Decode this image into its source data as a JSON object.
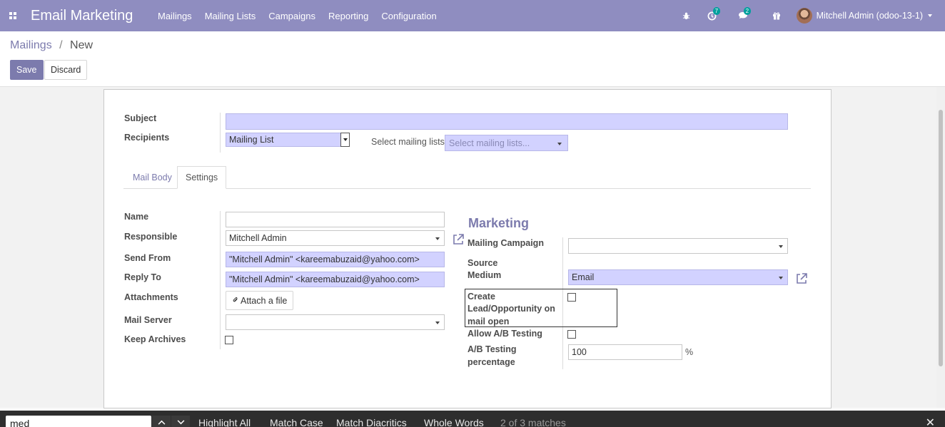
{
  "navbar": {
    "brand": "Email Marketing",
    "menu": [
      "Mailings",
      "Mailing Lists",
      "Campaigns",
      "Reporting",
      "Configuration"
    ],
    "activity_count": "7",
    "messages_count": "2",
    "user": "Mitchell Admin (odoo-13-1)"
  },
  "breadcrumb": {
    "parent": "Mailings",
    "separator": "/",
    "current": "New"
  },
  "buttons": {
    "save": "Save",
    "discard": "Discard"
  },
  "form": {
    "subject_label": "Subject",
    "subject_value": "",
    "recipients_label": "Recipients",
    "recipients_value": "Mailing List",
    "select_lists_label": "Select mailing lists:",
    "select_lists_placeholder": "Select mailing lists...",
    "tabs": {
      "mail_body": "Mail Body",
      "settings": "Settings"
    },
    "settings": {
      "name_label": "Name",
      "name_value": "",
      "responsible_label": "Responsible",
      "responsible_value": "Mitchell Admin",
      "send_from_label": "Send From",
      "send_from_value": "\"Mitchell Admin\" <kareemabuzaid@yahoo.com>",
      "reply_to_label": "Reply To",
      "reply_to_value": "\"Mitchell Admin\" <kareemabuzaid@yahoo.com>",
      "attachments_label": "Attachments",
      "attach_button": "Attach a file",
      "mail_server_label": "Mail Server",
      "mail_server_value": "",
      "keep_archives_label": "Keep Archives"
    },
    "marketing": {
      "title": "Marketing",
      "campaign_label": "Mailing Campaign",
      "campaign_value": "",
      "source_label": "Source",
      "medium_label": "Medium",
      "medium_value": "Email",
      "create_lead_label_1": "Create",
      "create_lead_label_2": "Lead/Opportunity on",
      "create_lead_label_3": "mail open",
      "ab_testing_label": "Allow A/B Testing",
      "ab_pct_label_1": "A/B Testing",
      "ab_pct_label_2": "percentage",
      "ab_pct_value": "100",
      "ab_pct_unit": "%"
    }
  },
  "findbar": {
    "query": "med",
    "highlight_all": "Highlight All",
    "match_case": "Match Case",
    "match_diacritics": "Match Diacritics",
    "whole_words": "Whole Words",
    "status": "2 of 3 matches"
  },
  "colors": {
    "brand": "#8f8dc0",
    "accent": "#7c7bad",
    "required_field": "#d2d2ff",
    "badge": "#00a09d"
  }
}
